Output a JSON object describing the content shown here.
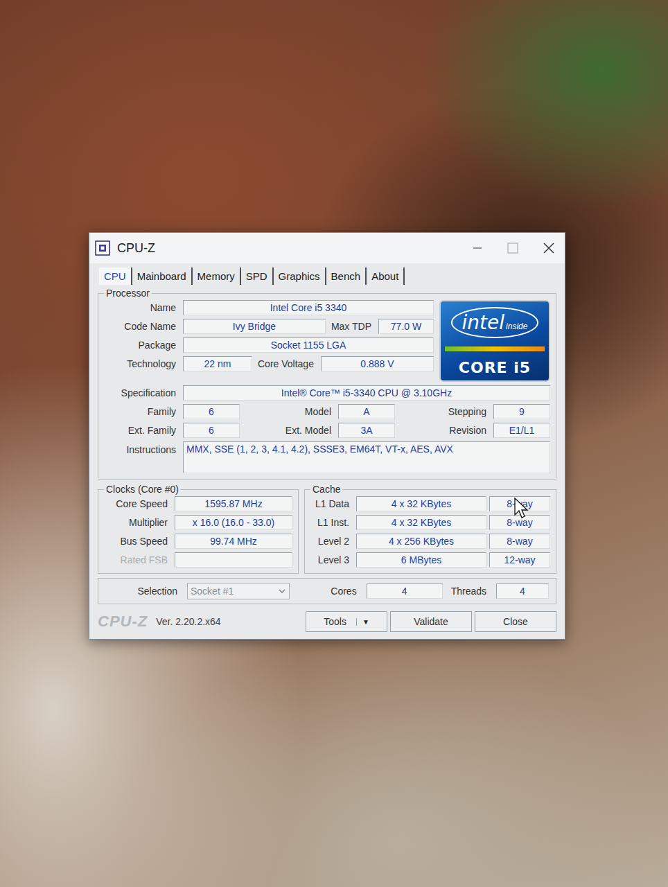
{
  "window": {
    "title": "CPU-Z"
  },
  "tabs": [
    {
      "label": "CPU",
      "selected": true
    },
    {
      "label": "Mainboard",
      "selected": false
    },
    {
      "label": "Memory",
      "selected": false
    },
    {
      "label": "SPD",
      "selected": false
    },
    {
      "label": "Graphics",
      "selected": false
    },
    {
      "label": "Bench",
      "selected": false
    },
    {
      "label": "About",
      "selected": false
    }
  ],
  "processor": {
    "title": "Processor",
    "name": {
      "label": "Name",
      "value": "Intel Core i5 3340"
    },
    "codeName": {
      "label": "Code Name",
      "value": "Ivy Bridge"
    },
    "maxTdp": {
      "label": "Max TDP",
      "value": "77.0 W"
    },
    "package": {
      "label": "Package",
      "value": "Socket 1155 LGA"
    },
    "technology": {
      "label": "Technology",
      "value": "22 nm"
    },
    "coreVoltage": {
      "label": "Core Voltage",
      "value": "0.888 V"
    },
    "logo": {
      "brand": "intel",
      "tagline": "inside",
      "product": "CORE i5"
    },
    "specification": {
      "label": "Specification",
      "value": "Intel® Core™ i5-3340 CPU @ 3.10GHz"
    },
    "ids": [
      [
        {
          "label": "Family",
          "value": "6"
        },
        {
          "label": "Model",
          "value": "A"
        },
        {
          "label": "Stepping",
          "value": "9"
        }
      ],
      [
        {
          "label": "Ext. Family",
          "value": "6"
        },
        {
          "label": "Ext. Model",
          "value": "3A"
        },
        {
          "label": "Revision",
          "value": "E1/L1"
        }
      ]
    ],
    "instructions": {
      "label": "Instructions",
      "value": "MMX, SSE (1, 2, 3, 4.1, 4.2), SSSE3, EM64T, VT-x, AES, AVX"
    }
  },
  "clocks": {
    "title": "Clocks (Core #0)",
    "rows": [
      {
        "label": "Core Speed",
        "value": "1595.87 MHz",
        "disabled": false
      },
      {
        "label": "Multiplier",
        "value": "x 16.0 (16.0 - 33.0)",
        "disabled": false
      },
      {
        "label": "Bus Speed",
        "value": "99.74 MHz",
        "disabled": false
      },
      {
        "label": "Rated FSB",
        "value": "",
        "disabled": true
      }
    ]
  },
  "cache": {
    "title": "Cache",
    "rows": [
      {
        "label": "L1 Data",
        "size": "4 x 32 KBytes",
        "ways": "8-way"
      },
      {
        "label": "L1 Inst.",
        "size": "4 x 32 KBytes",
        "ways": "8-way"
      },
      {
        "label": "Level 2",
        "size": "4 x 256 KBytes",
        "ways": "8-way"
      },
      {
        "label": "Level 3",
        "size": "6 MBytes",
        "ways": "12-way"
      }
    ]
  },
  "selection": {
    "label": "Selection",
    "value": "Socket #1",
    "disabled": true
  },
  "cores": {
    "label": "Cores",
    "value": "4"
  },
  "threads": {
    "label": "Threads",
    "value": "4"
  },
  "footer": {
    "brand": "CPU-Z",
    "version": "Ver. 2.20.2.x64",
    "buttons": [
      {
        "label": "Tools",
        "arrow": "▼"
      },
      {
        "label": "Validate",
        "arrow": ""
      },
      {
        "label": "Close",
        "arrow": ""
      }
    ]
  }
}
